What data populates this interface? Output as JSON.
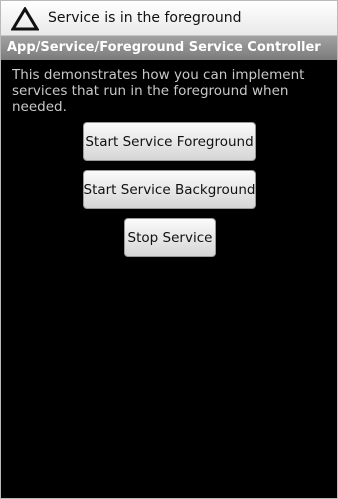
{
  "status_bar": {
    "icon": "warning-triangle-icon",
    "text": "Service is in the foreground"
  },
  "title_bar": {
    "title": "App/Service/Foreground Service Controller"
  },
  "content": {
    "description": "This demonstrates how you can implement services that run in the foreground when needed.",
    "buttons": {
      "start_foreground": "Start Service Foreground",
      "start_background": "Start Service Background",
      "stop": "Stop Service"
    }
  },
  "colors": {
    "background": "#000000",
    "title_bar": "#8f8f8f",
    "status_bar": "#f2f2f2",
    "description_text": "#c9c9c9"
  }
}
